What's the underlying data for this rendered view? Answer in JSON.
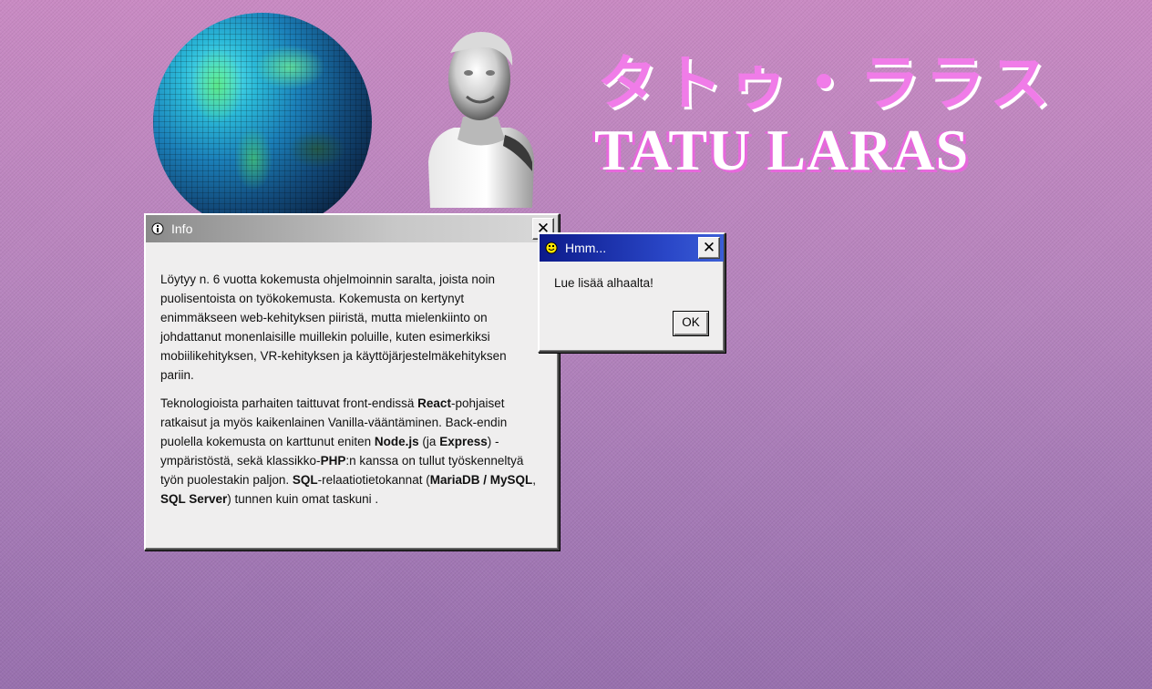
{
  "header": {
    "title_japanese": "タトゥ・ララス",
    "title_latin": "TATU LARAS"
  },
  "info_window": {
    "title": "Info",
    "close_label": "✕",
    "paragraph1": "Löytyy n. 6 vuotta kokemusta ohjelmoinnin saralta, joista noin puolisentoista on työkokemusta. Kokemusta on kertynyt enimmäkseen web-kehityksen piiristä, mutta mielenkiinto on johdattanut monenlaisille muillekin poluille, kuten esimerkiksi mobiilikehityksen, VR-kehityksen ja käyttöjärjestelmäkehityksen pariin.",
    "p2": {
      "t1": "Teknologioista parhaiten taittuvat front-endissä ",
      "b1": "React",
      "t2": "-pohjaiset ratkaisut ja myös kaikenlainen Vanilla-vääntäminen. Back-endin puolella kokemusta on karttunut eniten ",
      "b2": "Node.js",
      "t3": " (ja ",
      "b3": "Express",
      "t4": ") -ympäristöstä, sekä klassikko-",
      "b4": "PHP",
      "t5": ":n kanssa on tullut työskenneltyä työn puolestakin paljon. ",
      "b5": "SQL",
      "t6": "-relaatiotietokannat (",
      "b6": "MariaDB / MySQL",
      "t7": ", ",
      "b7": "SQL Server",
      "t8": ") tunnen kuin omat taskuni ."
    }
  },
  "hmm_dialog": {
    "title": "Hmm...",
    "close_label": "✕",
    "message": "Lue lisää alhaalta!",
    "ok_label": "OK"
  },
  "colors": {
    "background_top": "#c98ac3",
    "background_bottom": "#9870ae",
    "title_pink": "#f07ce8",
    "dialog_titlebar_blue": "#0c1a8a"
  },
  "icons": {
    "globe": "pixel-globe-image",
    "bust": "statue-bust-image",
    "info": "info-icon",
    "smiley": "smiley-icon"
  }
}
